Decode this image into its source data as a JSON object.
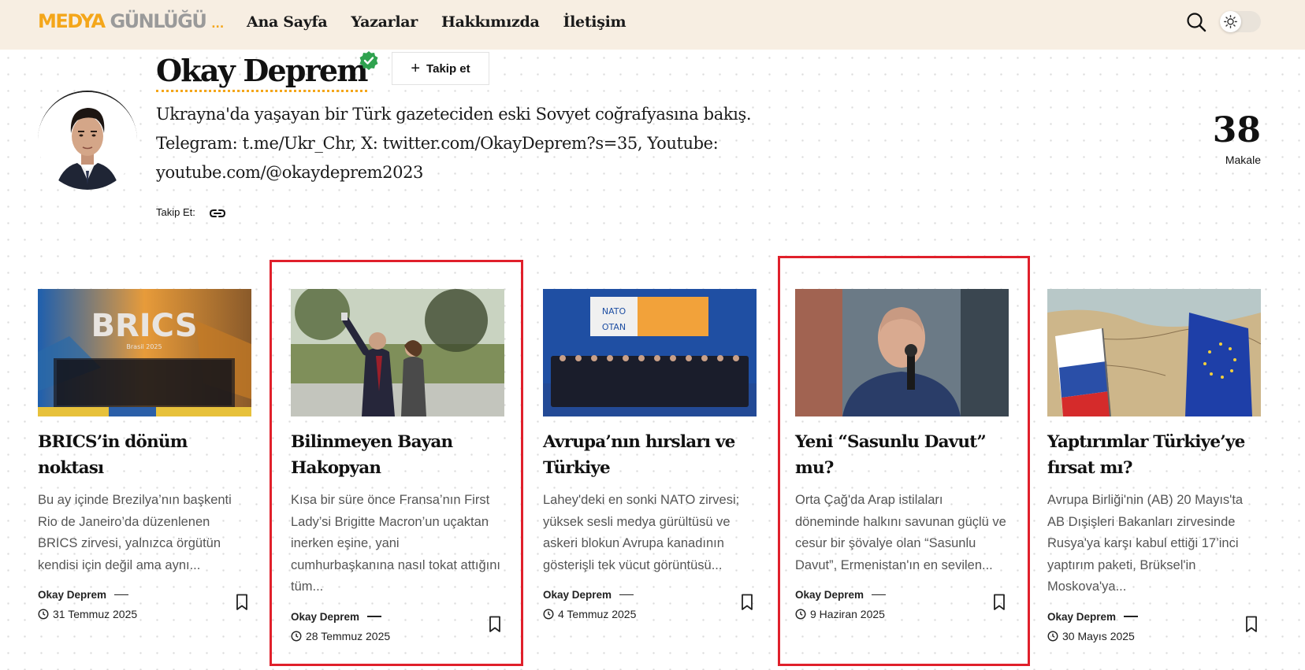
{
  "header": {
    "logo_part1": "MEDYA",
    "logo_part2": "GÜNLÜĞÜ",
    "logo_dots": "...",
    "nav": [
      "Ana Sayfa",
      "Yazarlar",
      "Hakkımızda",
      "İletişim"
    ],
    "icons": {
      "search": "search-icon",
      "theme": "sun-icon"
    },
    "accent_color": "#f4a61a",
    "bg_color": "#f7eee2"
  },
  "profile": {
    "name": "Okay Deprem",
    "follow_label": "Takip et",
    "bio": "Ukrayna'da yaşayan bir Türk gazeteciden eski Sovyet coğrafyasına bakış. Telegram: t.me/Ukr_Chr, X: twitter.com/OkayDeprem?s=35, Youtube: youtube.com/@okaydeprem2023",
    "follow_us": "Takip Et:",
    "article_count": "38",
    "article_label": "Makale",
    "verified_color": "#2fa24f"
  },
  "cards": [
    {
      "title": "BRICS’in dönüm noktası",
      "excerpt": "  Bu ay içinde Brezilya’nın başkenti Rio de Janeiro’da düzenlenen BRICS zirvesi, yalnızca örgütün kendisi için değil ama aynı...",
      "author": "Okay Deprem",
      "date": "31 Temmuz 2025",
      "image_text": "BRICS",
      "image_sub": "Brasil 2025"
    },
    {
      "title": "Bilinmeyen Bayan Hakopyan",
      "excerpt": "Kısa bir süre önce Fransa’nın First Lady’si Brigitte Macron’un uçaktan inerken eşine, yani cumhurbaşkanına nasıl tokat attığını tüm...",
      "author": "Okay Deprem",
      "date": "28 Temmuz 2025"
    },
    {
      "title": "Avrupa’nın hırsları ve Türkiye",
      "excerpt": "Lahey'deki en sonki NATO zirvesi; yüksek sesli medya gürültüsü ve askeri blokun Avrupa kanadının gösterişli tek vücut görüntüsü...",
      "author": "Okay Deprem",
      "date": "4 Temmuz 2025",
      "image_text": "NATO",
      "image_sub": "OTAN"
    },
    {
      "title": "Yeni “Sasunlu Davut” mu?",
      "excerpt": "Orta Çağ'da Arap istilaları döneminde halkını savunan güçlü ve cesur bir şövalye olan “Sasunlu Davut”, Ermenistan'ın en sevilen...",
      "author": "Okay Deprem",
      "date": "9 Haziran 2025"
    },
    {
      "title": "Yaptırımlar Türkiye’ye fırsat mı?",
      "excerpt": "Avrupa Birliği'nin (AB) 20 Mayıs'ta AB Dışişleri Bakanları zirvesinde Rusya'ya karşı kabul ettiği 17’inci yaptırım paketi, Brüksel'in Moskova'ya...",
      "author": "Okay Deprem",
      "date": "30 Mayıs 2025"
    }
  ],
  "highlight_color": "#e0202b"
}
